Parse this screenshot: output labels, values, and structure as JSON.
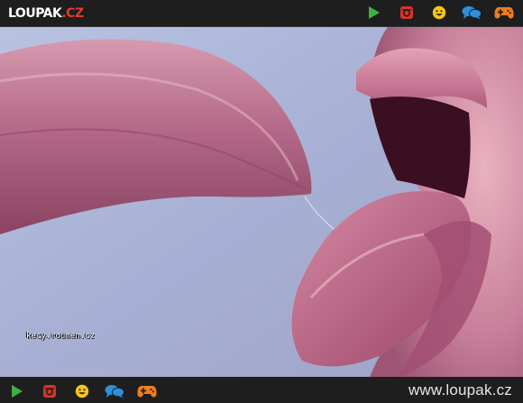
{
  "header": {
    "logo_name": "LOUPAK",
    "logo_tld": ".CZ",
    "icons": [
      "play-icon",
      "instagram-icon",
      "smiley-icon",
      "chat-icon",
      "gamepad-icon"
    ]
  },
  "photo": {
    "watermark": "kecy.roumen.cz"
  },
  "footer": {
    "icons": [
      "play-icon",
      "instagram-icon",
      "smiley-icon",
      "chat-icon",
      "gamepad-icon"
    ],
    "site_url": "www.loupak.cz"
  },
  "colors": {
    "bar_bg": "#1e1e1e",
    "play": "#3cb043",
    "instagram": "#d9322b",
    "smiley": "#f5c518",
    "chat": "#2f8fd8",
    "gamepad": "#f07d1a",
    "logo_tld": "#e33a2a"
  }
}
